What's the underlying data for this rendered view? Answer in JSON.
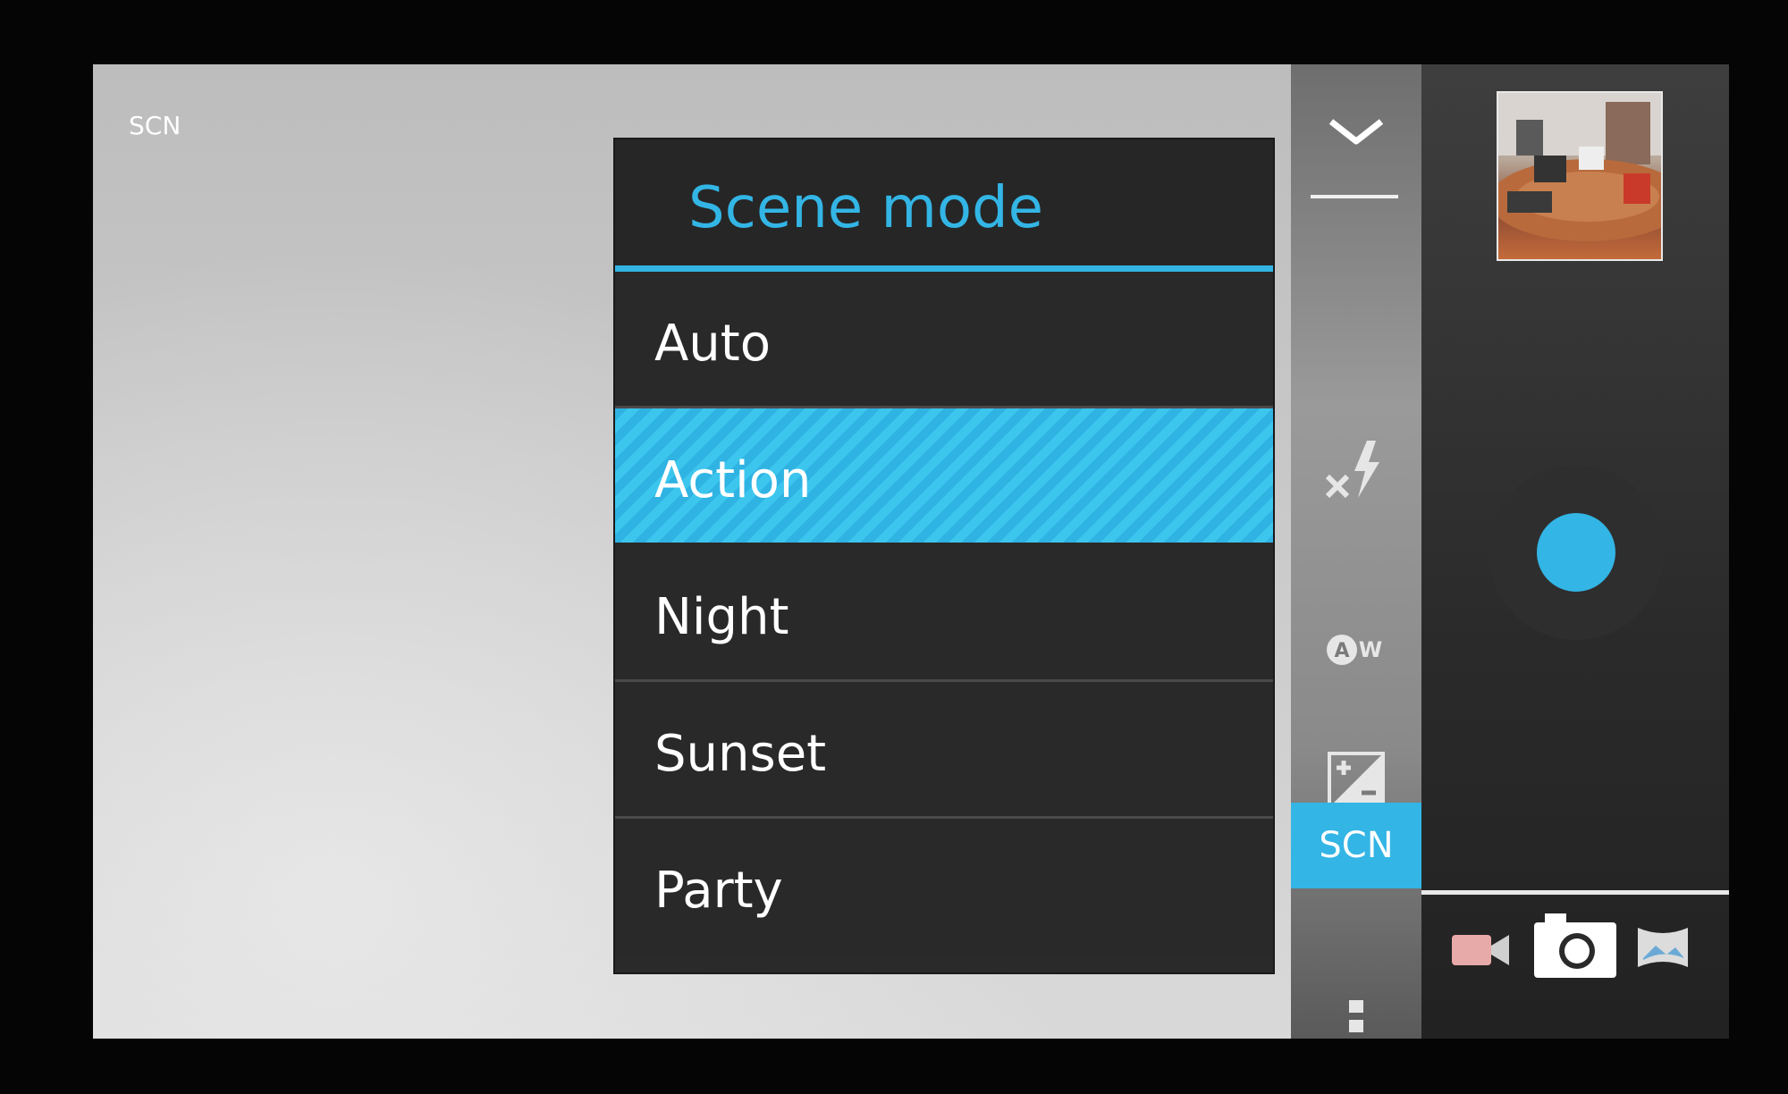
{
  "viewfinder": {
    "scene_indicator": "SCN"
  },
  "scene_mode": {
    "title": "Scene mode",
    "options": [
      "Auto",
      "Action",
      "Night",
      "Sunset",
      "Party"
    ],
    "selected": "Action"
  },
  "settings": {
    "collapse_icon": "chevron-down-icon",
    "flash_icon": "flash-off-icon",
    "white_balance_icon": "auto-white-balance-icon",
    "exposure_icon": "exposure-icon",
    "scene_button_label": "SCN",
    "more_icon": "overflow-menu-icon"
  },
  "modes": {
    "video_icon": "video-camera-icon",
    "photo_icon": "camera-icon",
    "panorama_icon": "panorama-icon"
  },
  "colors": {
    "accent": "#33b5e5",
    "popup_background": "#2a2a2a",
    "text": "#ffffff"
  }
}
